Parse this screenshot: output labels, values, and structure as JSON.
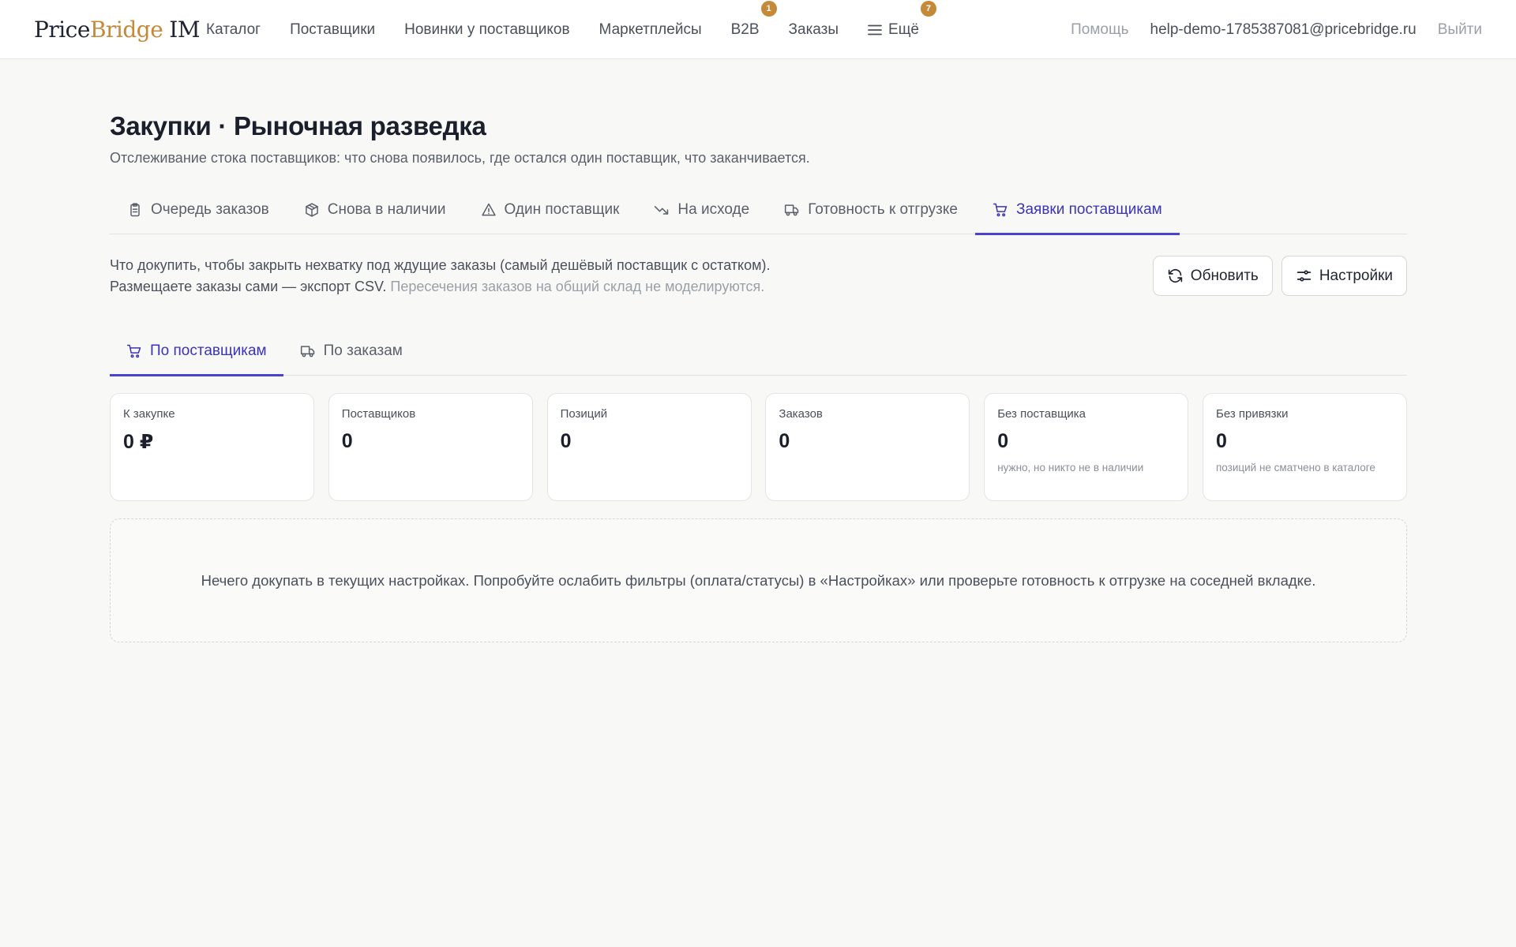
{
  "brand": {
    "part1": "Price",
    "part2": "Bridge",
    "part3": "IM",
    "accent_color": "#c48a3a"
  },
  "nav": {
    "items": [
      {
        "label": "Каталог"
      },
      {
        "label": "Поставщики"
      },
      {
        "label": "Новинки у поставщиков"
      },
      {
        "label": "Маркетплейсы"
      },
      {
        "label": "B2B",
        "badge": "1"
      },
      {
        "label": "Заказы"
      },
      {
        "label": "Ещё",
        "badge": "7",
        "icon": "menu-icon"
      }
    ],
    "help": "Помощь",
    "email": "help-demo-1785387081@pricebridge.ru",
    "logout": "Выйти"
  },
  "page": {
    "title": "Закупки · Рыночная разведка",
    "subtitle": "Отслеживание стока поставщиков: что снова появилось, где остался один поставщик, что заканчивается."
  },
  "tabs": [
    {
      "label": "Очередь заказов",
      "icon": "clipboard-icon"
    },
    {
      "label": "Снова в наличии",
      "icon": "package-icon"
    },
    {
      "label": "Один поставщик",
      "icon": "warning-icon"
    },
    {
      "label": "На исходе",
      "icon": "trending-down-icon"
    },
    {
      "label": "Готовность к отгрузке",
      "icon": "truck-icon"
    },
    {
      "label": "Заявки поставщикам",
      "icon": "cart-icon",
      "active": true
    }
  ],
  "intro": {
    "text": "Что докупить, чтобы закрыть нехватку под ждущие заказы (самый дешёвый поставщик с остатком). Размещаете заказы сами — экспорт CSV.",
    "muted": "Пересечения заказов на общий склад не моделируются."
  },
  "actions": {
    "refresh": "Обновить",
    "settings": "Настройки"
  },
  "subtabs": [
    {
      "label": "По поставщикам",
      "icon": "cart-icon",
      "active": true
    },
    {
      "label": "По заказам",
      "icon": "truck-icon"
    }
  ],
  "stats": [
    {
      "label": "К закупке",
      "value": "0 ₽",
      "note": ""
    },
    {
      "label": "Поставщиков",
      "value": "0",
      "note": ""
    },
    {
      "label": "Позиций",
      "value": "0",
      "note": ""
    },
    {
      "label": "Заказов",
      "value": "0",
      "note": ""
    },
    {
      "label": "Без поставщика",
      "value": "0",
      "note": "нужно, но никто не в наличии"
    },
    {
      "label": "Без привязки",
      "value": "0",
      "note": "позиций не сматчено в каталоге"
    }
  ],
  "empty_state": "Нечего докупать в текущих настройках. Попробуйте ослабить фильтры (оплата/статусы) в «Настройках» или проверьте готовность к отгрузке на соседней вкладке.",
  "colors": {
    "active_tab": "#4a42d0",
    "badge": "#c48a3a"
  }
}
